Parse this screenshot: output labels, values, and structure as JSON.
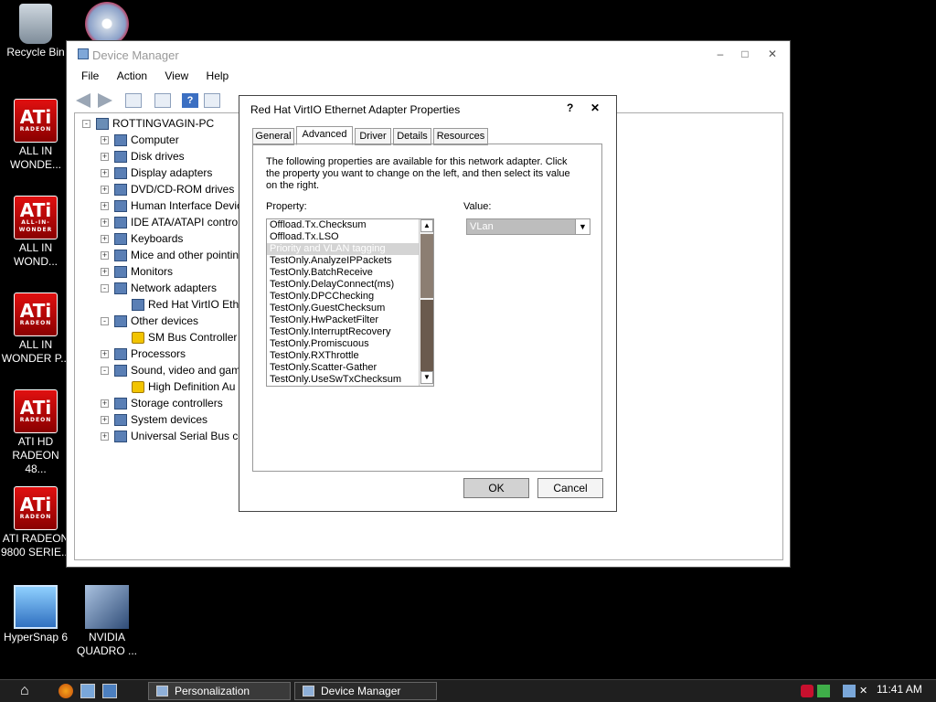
{
  "desktop": {
    "icons": [
      {
        "label1": "Recycle Bin",
        "label2": ""
      },
      {
        "label1": "ALL IN",
        "label2": "WONDE..."
      },
      {
        "label1": "ALL IN",
        "label2": "WOND..."
      },
      {
        "label1": "ALL IN",
        "label2": "WONDER P..."
      },
      {
        "label1": "ATI HD",
        "label2": "RADEON 48..."
      },
      {
        "label1": "ATI RADEON",
        "label2": "9800 SERIE..."
      },
      {
        "label1": "HyperSnap 6",
        "label2": ""
      },
      {
        "label1": "NVIDIA",
        "label2": "QUADRO ..."
      }
    ]
  },
  "device_manager": {
    "title": "Device Manager",
    "menu": [
      "File",
      "Action",
      "View",
      "Help"
    ],
    "tree": [
      {
        "label": "ROTTINGVAGIN-PC",
        "exp": "-"
      },
      {
        "label": "Computer",
        "exp": "+"
      },
      {
        "label": "Disk drives",
        "exp": "+"
      },
      {
        "label": "Display adapters",
        "exp": "+"
      },
      {
        "label": "DVD/CD-ROM drives",
        "exp": "+"
      },
      {
        "label": "Human Interface Devic",
        "exp": "+"
      },
      {
        "label": "IDE ATA/ATAPI contro",
        "exp": "+"
      },
      {
        "label": "Keyboards",
        "exp": "+"
      },
      {
        "label": "Mice and other pointin",
        "exp": "+"
      },
      {
        "label": "Monitors",
        "exp": "+"
      },
      {
        "label": "Network adapters",
        "exp": "-"
      },
      {
        "label": "Red Hat VirtIO Ethe",
        "exp": ""
      },
      {
        "label": "Other devices",
        "exp": "-"
      },
      {
        "label": "SM Bus Controller",
        "exp": ""
      },
      {
        "label": "Processors",
        "exp": "+"
      },
      {
        "label": "Sound, video and gam",
        "exp": "-"
      },
      {
        "label": "High Definition Au",
        "exp": ""
      },
      {
        "label": "Storage controllers",
        "exp": "+"
      },
      {
        "label": "System devices",
        "exp": "+"
      },
      {
        "label": "Universal Serial Bus co",
        "exp": "+"
      }
    ]
  },
  "dialog": {
    "title": "Red Hat VirtIO Ethernet Adapter Properties",
    "help": "?",
    "close": "✕",
    "tabs": [
      "General",
      "Advanced",
      "Driver",
      "Details",
      "Resources"
    ],
    "active_tab": "Advanced",
    "description": "The following properties are available for this network adapter. Click the property you want to change on the left, and then select its value on the right.",
    "property_label": "Property:",
    "value_label": "Value:",
    "properties": [
      "Offload.Tx.Checksum",
      "Offload.Tx.LSO",
      "Priority and VLAN tagging",
      "TestOnly.AnalyzeIPPackets",
      "TestOnly.BatchReceive",
      "TestOnly.DelayConnect(ms)",
      "TestOnly.DPCChecking",
      "TestOnly.GuestChecksum",
      "TestOnly.HwPacketFilter",
      "TestOnly.InterruptRecovery",
      "TestOnly.Promiscuous",
      "TestOnly.RXThrottle",
      "TestOnly.Scatter-Gather",
      "TestOnly.UseSwTxChecksum"
    ],
    "selected_property": "Priority and VLAN tagging",
    "value": "VLan",
    "ok": "OK",
    "cancel": "Cancel"
  },
  "taskbar": {
    "tasks": [
      "Personalization",
      "Device Manager"
    ],
    "clock": "11:41 AM"
  }
}
